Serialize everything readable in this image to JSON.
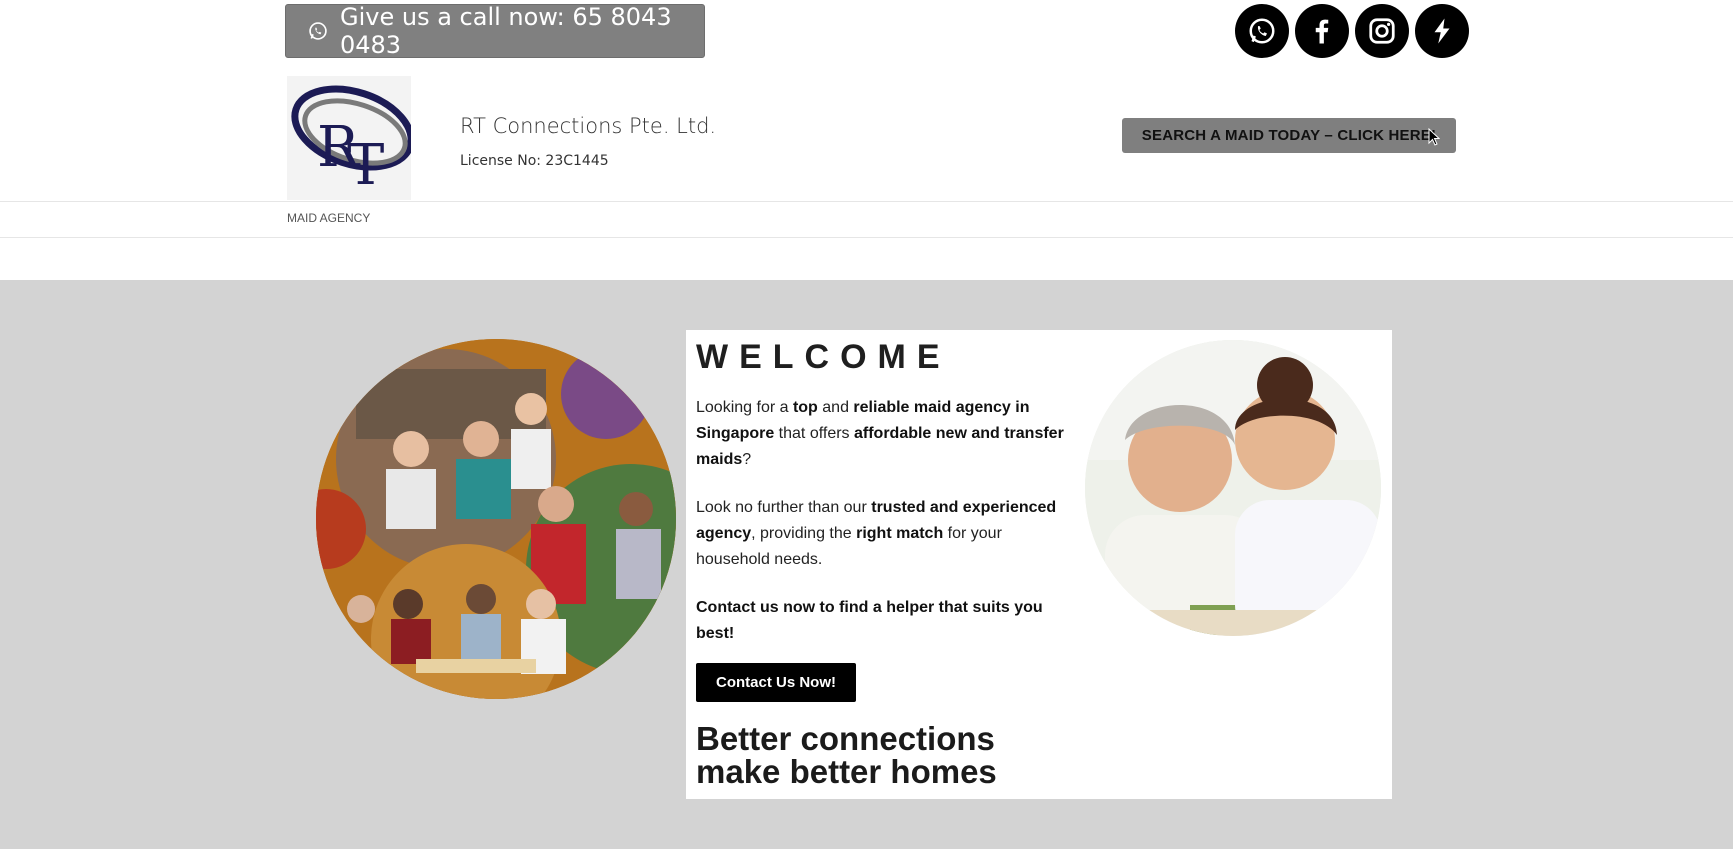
{
  "topbar": {
    "call_label": "Give us a call now: 65 8043 0483",
    "socials": [
      {
        "icon": "whatsapp-icon"
      },
      {
        "icon": "facebook-icon"
      },
      {
        "icon": "instagram-icon"
      },
      {
        "icon": "lightning-icon"
      }
    ]
  },
  "header": {
    "logo_text": "RT",
    "company_name": "RT Connections Pte. Ltd.",
    "license": "License No: 23C1445",
    "search_button": "SEARCH A MAID TODAY – CLICK HERE!"
  },
  "nav": {
    "items": [
      {
        "label": "MAID AGENCY"
      }
    ]
  },
  "hero": {
    "welcome": "WELCOME",
    "p1": {
      "t1": "Looking for a ",
      "b1": "top",
      "t2": " and ",
      "b2": "reliable maid agency in Singapore",
      "t3": " that offers ",
      "b3": "affordable new and transfer maids",
      "t4": "?"
    },
    "p2": {
      "t1": "Look no further than our ",
      "b1": "trusted and experienced agency",
      "t2": ", providing the ",
      "b2": "right match",
      "t3": " for your household needs."
    },
    "p3": "Contact us now to find a helper that suits you best!",
    "contact_button": "Contact Us Now!",
    "tagline_line1": "Better connections",
    "tagline_line2": "make better homes"
  },
  "colors": {
    "call_button_bg": "#808080",
    "search_button_bg": "#7f7f7f",
    "hero_bg": "#d3d3d3",
    "logo_navy": "#1c1b55",
    "collage_orange": "#b8731d"
  }
}
